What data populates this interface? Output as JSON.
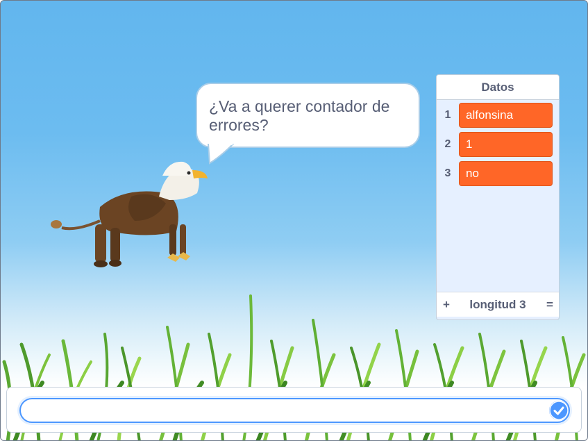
{
  "stage": {
    "backdrop": "blue sky with grass",
    "sprite": "griffin"
  },
  "speech_bubble": {
    "line1": "¿Va a querer contador de",
    "line2": "errores?"
  },
  "list_monitor": {
    "title": "Datos",
    "items": [
      {
        "index": "1",
        "value": "alfonsina"
      },
      {
        "index": "2",
        "value": "1"
      },
      {
        "index": "3",
        "value": "no"
      }
    ],
    "add_label": "+",
    "length_label": "longitud 3",
    "resize_label": "="
  },
  "ask_prompt": {
    "value": "",
    "submit_icon": "check-circle-icon"
  },
  "colors": {
    "list_item": "#ff6627",
    "accent": "#4c97ff",
    "text": "#575e75"
  }
}
